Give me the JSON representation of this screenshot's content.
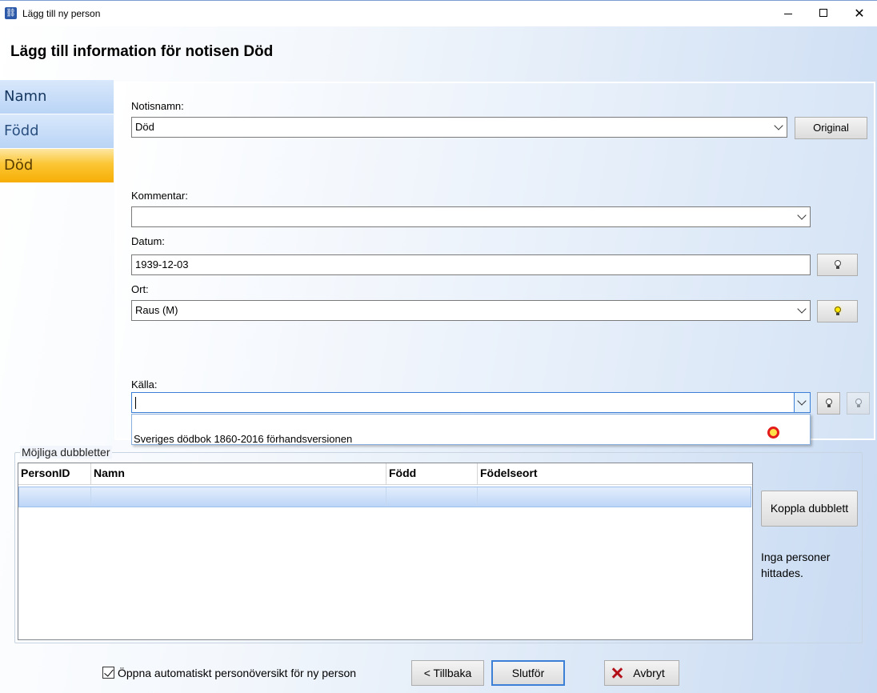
{
  "window": {
    "title": "Lägg till ny person",
    "min_glyph": "",
    "close_glyph": "✕"
  },
  "page": {
    "title": "Lägg till information för notisen Död"
  },
  "nav": {
    "items": [
      {
        "label": "Namn"
      },
      {
        "label": "Född"
      },
      {
        "label": "Död",
        "selected": true
      }
    ]
  },
  "form": {
    "notisnamn_label": "Notisnamn:",
    "notisnamn_value": "Död",
    "original_button": "Original",
    "kommentar_label": "Kommentar:",
    "kommentar_value": "",
    "datum_label": "Datum:",
    "datum_value": "1939-12-03",
    "ort_label": "Ort:",
    "ort_value": "Raus (M)",
    "kalla_label": "Källa:",
    "kalla_value": "",
    "kalla_dropdown_items": [
      "Sveriges dödbok 1860-2016 förhandsversionen"
    ]
  },
  "duplicates": {
    "group_title": "Möjliga dubbletter",
    "columns": [
      "PersonID",
      "Namn",
      "Född",
      "Födelseort"
    ],
    "link_button": "Koppla dubblett",
    "status": "Inga personer hittades."
  },
  "footer": {
    "auto_overview_label": "Öppna automatiskt personöversikt för ny person",
    "auto_overview_checked": true,
    "back_button": "< Tillbaka",
    "finish_button": "Slutför",
    "cancel_button": "Avbryt"
  },
  "colors": {
    "selected_nav": "#f7ae05",
    "nav": "#b9d4f6",
    "focus": "#3c7fd6",
    "cancel_icon": "#b3121b"
  }
}
